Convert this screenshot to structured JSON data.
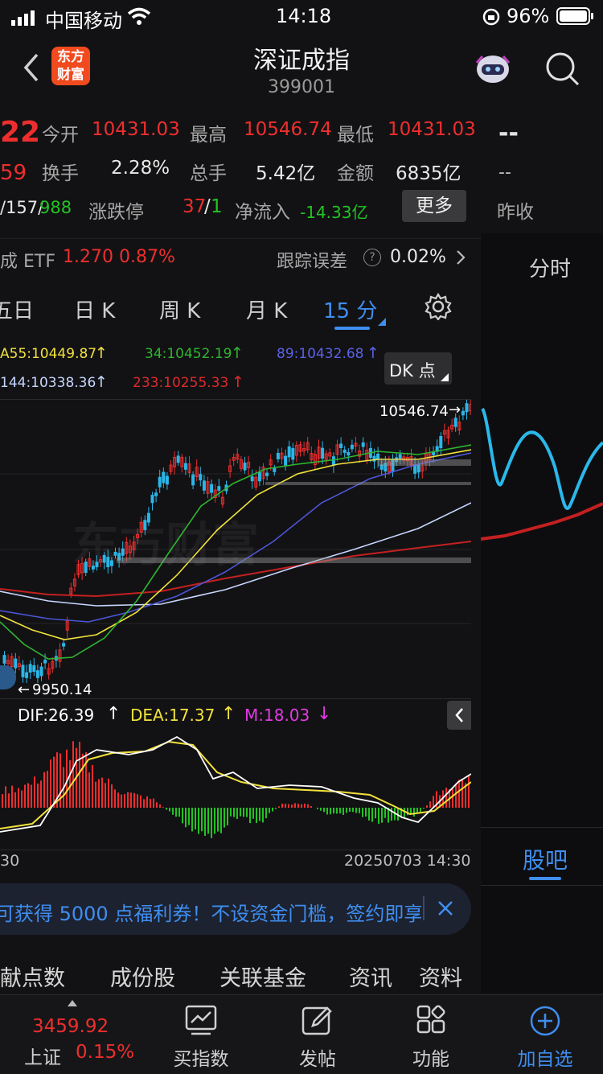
{
  "status_bar": {
    "carrier": "中国移动",
    "time": "14:18",
    "battery": "96%"
  },
  "header": {
    "title": "深证成指",
    "code": "399001",
    "logo_text_1": "东方",
    "logo_text_2": "财富"
  },
  "quote": {
    "price_partial": "22",
    "change_partial": "59",
    "open_label": "今开",
    "open": "10431.03",
    "high_label": "最高",
    "high": "10546.74",
    "low_label": "最低",
    "low": "10431.03",
    "turnover_label": "换手",
    "turnover": "2.28%",
    "volume_label": "总手",
    "volume": "5.42亿",
    "amount_label": "金额",
    "amount": "6835亿",
    "updown_partial": "/157/",
    "down_count": "988",
    "limit_label": "涨跌停",
    "limit_up": "37",
    "limit_sep": "/",
    "limit_down": "1",
    "netflow_label": "净流入",
    "netflow": "-14.33亿",
    "more_button": "更多",
    "right_dash_1": "--",
    "right_dash_2": "--",
    "prev_close_label": "昨收"
  },
  "etf": {
    "name": "成 ETF",
    "price": "1.270",
    "change": "0.87%",
    "tracking_label": "跟踪误差",
    "tracking_value": "0.02%"
  },
  "period_tabs": [
    "五日",
    "日 K",
    "周 K",
    "月 K",
    "15 分"
  ],
  "active_tab": "15 分",
  "ma": {
    "ma55": "A55:10449.87",
    "ma34": "34:10452.19",
    "ma89": "89:10432.68",
    "ma144": "144:10338.36",
    "ma233": "233:10255.33",
    "dk_button": "DK 点"
  },
  "chart_labels": {
    "high_marker": "10546.74",
    "low_marker": "9950.14",
    "watermark": "东方财富"
  },
  "macd": {
    "dif": "DIF:26.39",
    "dea": "DEA:17.37",
    "m": "M:18.03"
  },
  "time_axis": {
    "left": "30",
    "right": "20250703 14:30"
  },
  "right_panel": {
    "fenshi": "分时",
    "guba": "股吧"
  },
  "banner": {
    "text": "可获得 5000 点福利券！不设资金门槛，签约即享"
  },
  "sub_tabs": [
    "献点数",
    "成份股",
    "关联基金",
    "资讯",
    "资料"
  ],
  "bottom_nav": {
    "index_value": "3459.92",
    "index_name": "上证",
    "index_change": "0.15%",
    "items": [
      "买指数",
      "发帖",
      "功能",
      "加自选"
    ]
  },
  "colors": {
    "up": "#ee2e2e",
    "down": "#22c422",
    "accent": "#3f8ef0",
    "bg": "#121214"
  },
  "chart_data": {
    "type": "candlestick",
    "price_range": [
      9950.14,
      10546.74
    ],
    "ma_series": [
      {
        "name": "MA34",
        "color": "#2fb52f"
      },
      {
        "name": "MA55",
        "color": "#f2e23c"
      },
      {
        "name": "MA89",
        "color": "#4d55d8"
      },
      {
        "name": "MA144",
        "color": "#c8d6ff"
      },
      {
        "name": "MA233",
        "color": "#d42020"
      }
    ]
  }
}
